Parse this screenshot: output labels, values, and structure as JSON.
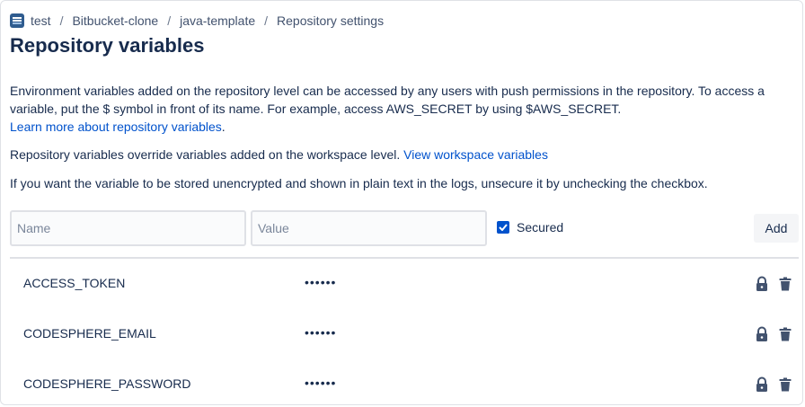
{
  "breadcrumb": {
    "items": [
      "test",
      "Bitbucket-clone",
      "java-template",
      "Repository settings"
    ],
    "separator": "/"
  },
  "page": {
    "title": "Repository variables"
  },
  "description": {
    "intro": "Environment variables added on the repository level can be accessed by any users with push permissions in the repository. To access a variable, put the $ symbol in front of its name. For example, access AWS_SECRET by using $AWS_SECRET.",
    "learn_more_link": "Learn more about repository variables",
    "learn_more_suffix": ".",
    "override_text": "Repository variables override variables added on the workspace level.",
    "workspace_link": "View workspace variables",
    "unsecure_text": "If you want the variable to be stored unencrypted and shown in plain text in the logs, unsecure it by unchecking the checkbox."
  },
  "form": {
    "name_placeholder": "Name",
    "name_value": "",
    "value_placeholder": "Value",
    "value_value": "",
    "secured_label": "Secured",
    "secured_checked": true,
    "add_label": "Add"
  },
  "variables": [
    {
      "name": "ACCESS_TOKEN",
      "value": "••••••",
      "icons": [
        "lock-icon",
        "trash-icon"
      ]
    },
    {
      "name": "CODESPHERE_EMAIL",
      "value": "••••••",
      "icons": [
        "lock-icon",
        "trash-icon"
      ]
    },
    {
      "name": "CODESPHERE_PASSWORD",
      "value": "••••••",
      "icons": [
        "lock-icon",
        "trash-icon"
      ]
    }
  ],
  "colors": {
    "link": "#0052cc",
    "text": "#172b4d",
    "checkbox": "#0052cc",
    "repo_icon": "#2f5c8f"
  }
}
